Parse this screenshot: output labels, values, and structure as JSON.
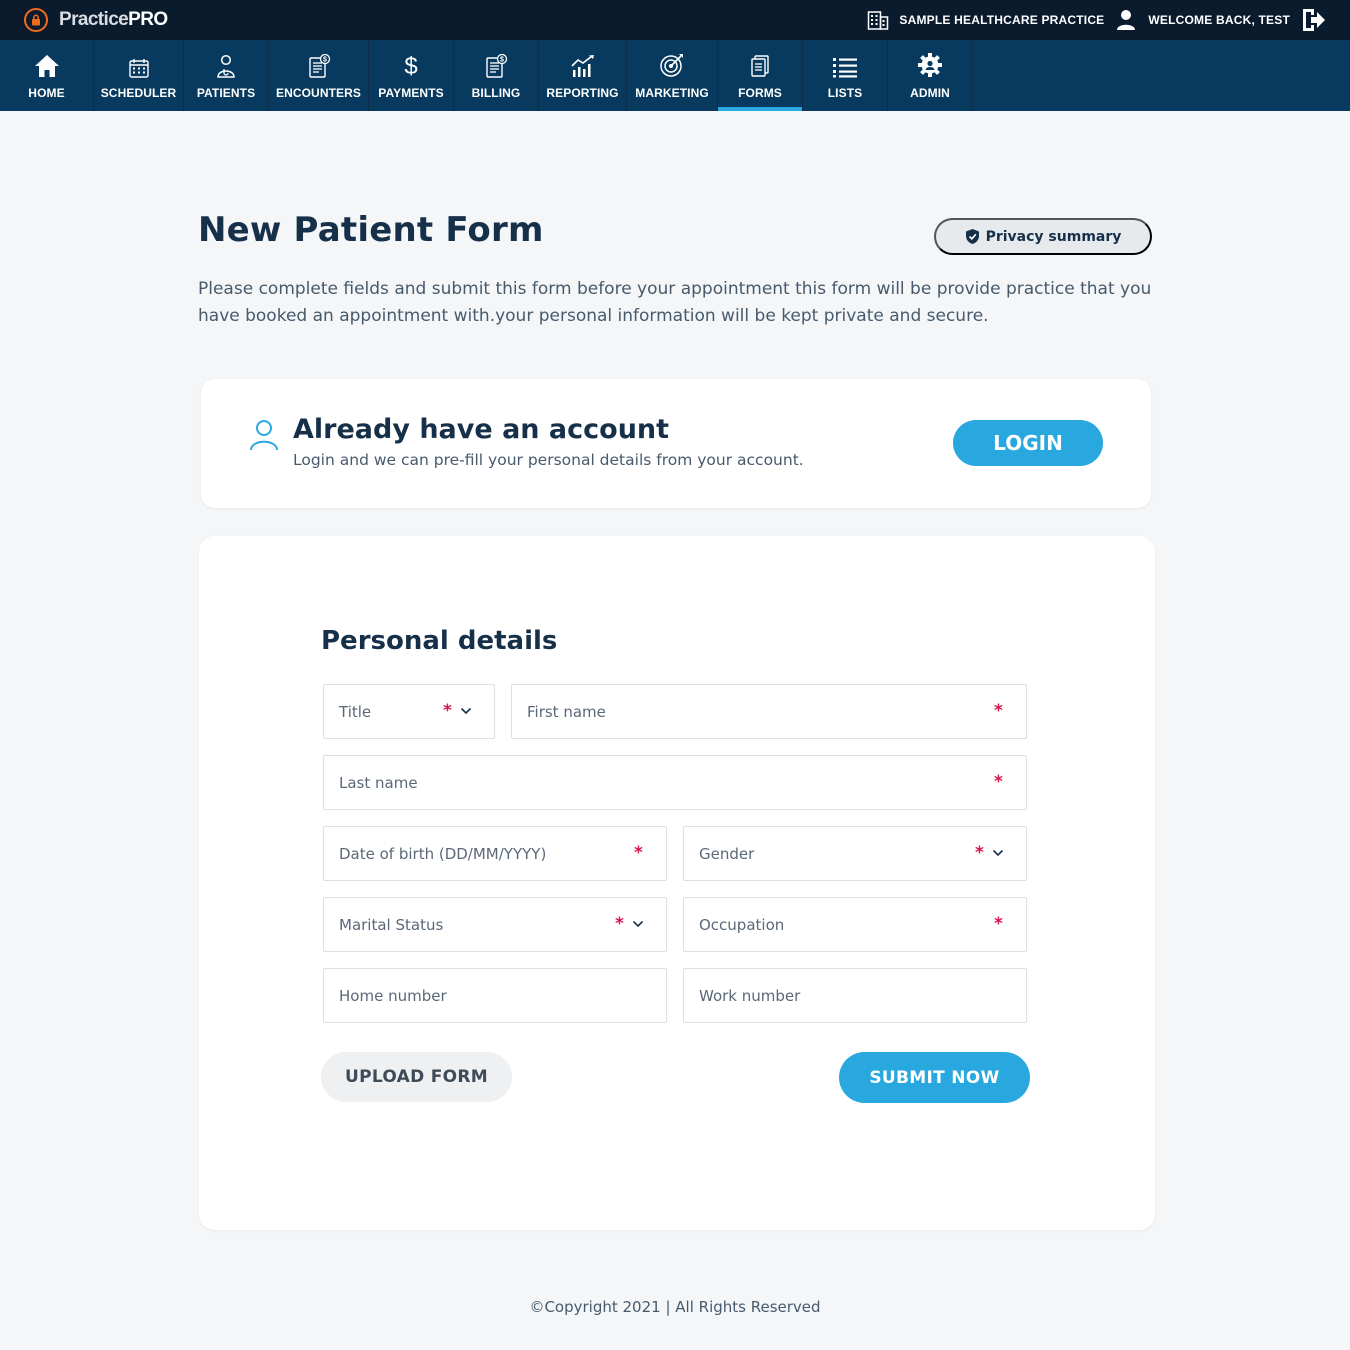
{
  "app": {
    "brand_light": "Practice",
    "brand_bold": "PRO",
    "practice_name": "SAMPLE HEALTHCARE PRACTICE",
    "welcome": "WELCOME BACK, TEST"
  },
  "colors": {
    "topbar": "#0b1b2e",
    "nav": "#073a5e",
    "accent": "#29a8e0",
    "logo_orange": "#f26a1b",
    "required": "#d8144a"
  },
  "nav": {
    "items": [
      {
        "label": "HOME",
        "icon": "home-icon"
      },
      {
        "label": "SCHEDULER",
        "icon": "calendar-icon"
      },
      {
        "label": "PATIENTS",
        "icon": "doctor-icon"
      },
      {
        "label": "ENCOUNTERS",
        "icon": "encounter-doc-icon"
      },
      {
        "label": "PAYMENTS",
        "icon": "dollar-icon"
      },
      {
        "label": "BILLING",
        "icon": "billing-doc-icon"
      },
      {
        "label": "REPORTING",
        "icon": "bar-chart-icon"
      },
      {
        "label": "MARKETING",
        "icon": "target-icon"
      },
      {
        "label": "FORMS",
        "icon": "forms-icon",
        "active": true
      },
      {
        "label": "LISTS",
        "icon": "list-icon"
      },
      {
        "label": "ADMIN",
        "icon": "gear-icon"
      }
    ]
  },
  "page": {
    "title": "New Patient Form",
    "privacy_label": "Privacy summary",
    "intro": "Please complete fields and submit this form before your appointment this form will be provide practice that you have booked an appointment with.your personal information will be kept private and secure."
  },
  "account": {
    "title": "Already have an account",
    "subtitle": "Login and we can pre-fill your personal details from your account.",
    "login_label": "LOGIN"
  },
  "form": {
    "section_title": "Personal details",
    "required_mark": "*",
    "fields": {
      "title": {
        "placeholder": "Title",
        "required": true,
        "dropdown": true
      },
      "first_name": {
        "placeholder": "First name",
        "required": true
      },
      "last_name": {
        "placeholder": "Last name",
        "required": true
      },
      "dob": {
        "placeholder": "Date of birth (DD/MM/YYYY)",
        "required": true
      },
      "gender": {
        "placeholder": "Gender",
        "required": true,
        "dropdown": true
      },
      "marital_status": {
        "placeholder": "Marital Status",
        "required": true,
        "dropdown": true
      },
      "occupation": {
        "placeholder": "Occupation",
        "required": true
      },
      "home_number": {
        "placeholder": "Home number",
        "required": false
      },
      "work_number": {
        "placeholder": "Work number",
        "required": false
      }
    },
    "upload_label": "UPLOAD FORM",
    "submit_label": "SUBMIT NOW"
  },
  "footer": {
    "copyright": "©Copyright 2021 | All Rights Reserved"
  }
}
